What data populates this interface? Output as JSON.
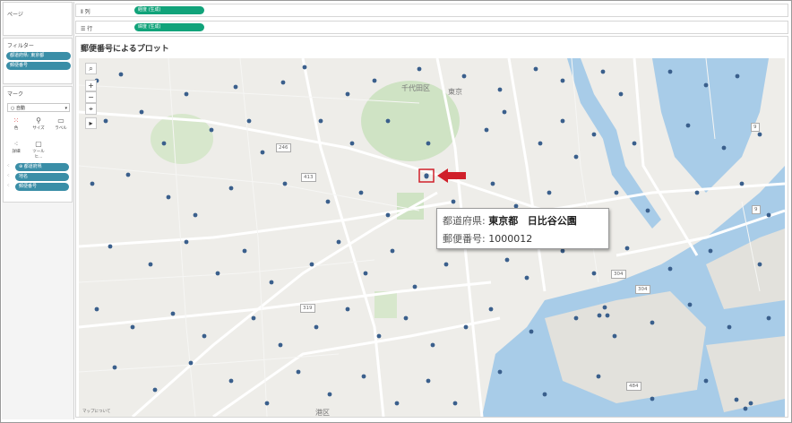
{
  "sidebar": {
    "pages_title": "ページ",
    "filters_title": "フィルター",
    "filters": [
      "都道府県: 東京都",
      "郵便番号"
    ],
    "marks_title": "マーク",
    "mark_type": "自動",
    "mark_buttons": [
      {
        "label": "色",
        "icon": "color-icon"
      },
      {
        "label": "サイズ",
        "icon": "size-icon"
      },
      {
        "label": "ラベル",
        "icon": "label-icon"
      },
      {
        "label": "詳細",
        "icon": "detail-icon"
      },
      {
        "label": "ツールヒ...",
        "icon": "tooltip-icon"
      }
    ],
    "mark_fields": [
      "都道府県",
      "地名",
      "郵便番号"
    ]
  },
  "shelves": {
    "columns_label": "列",
    "columns_pill": "経度 (生成)",
    "rows_label": "行",
    "rows_pill": "緯度 (生成)"
  },
  "viz": {
    "title": "郵便番号によるプロット",
    "map_labels": {
      "chiyoda": "千代田区",
      "tokyo": "東京",
      "minato": "港区"
    },
    "road_numbers": [
      "246",
      "413",
      "319",
      "304",
      "304",
      "484",
      "9",
      "9"
    ],
    "credit": "マップについて"
  },
  "tooltip": {
    "row1_label": "都道府県:",
    "row1_value1": "東京都",
    "row1_value2": "日比谷公園",
    "row2_label": "郵便番号:",
    "row2_value": "1000012"
  },
  "colors": {
    "teal_pill": "#3a8ea7",
    "green_pill": "#11a37a",
    "mark_dot": "#3a5f8c",
    "highlight": "#d0202a"
  }
}
